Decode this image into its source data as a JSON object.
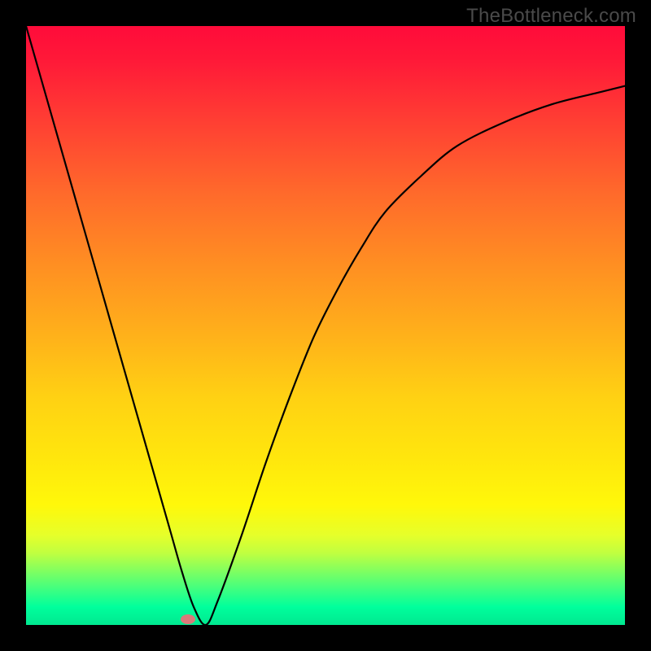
{
  "watermark": "TheBottleneck.com",
  "colors": {
    "frame": "#000000",
    "watermark_text": "#4a4a4a",
    "curve": "#000000",
    "marker": "#d97a7a",
    "gradient_stops": [
      "#ff0b3a",
      "#ff6a2b",
      "#ffd113",
      "#fff80a",
      "#00e890"
    ]
  },
  "chart_data": {
    "type": "line",
    "title": "",
    "xlabel": "",
    "ylabel": "",
    "xlim": [
      0,
      100
    ],
    "ylim": [
      0,
      100
    ],
    "grid": false,
    "legend": false,
    "series": [
      {
        "name": "bottleneck-curve",
        "x": [
          0,
          4,
          8,
          12,
          16,
          20,
          24,
          26,
          28,
          30,
          32,
          36,
          40,
          44,
          48,
          52,
          56,
          60,
          66,
          72,
          80,
          88,
          96,
          100
        ],
        "y": [
          100,
          86,
          72,
          58,
          44,
          30,
          16,
          9,
          3,
          0,
          4,
          15,
          27,
          38,
          48,
          56,
          63,
          69,
          75,
          80,
          84,
          87,
          89,
          90
        ]
      }
    ],
    "marker": {
      "x": 27,
      "y": 1,
      "shape": "ellipse",
      "color": "#d97a7a"
    },
    "background": "red-to-green vertical gradient"
  }
}
